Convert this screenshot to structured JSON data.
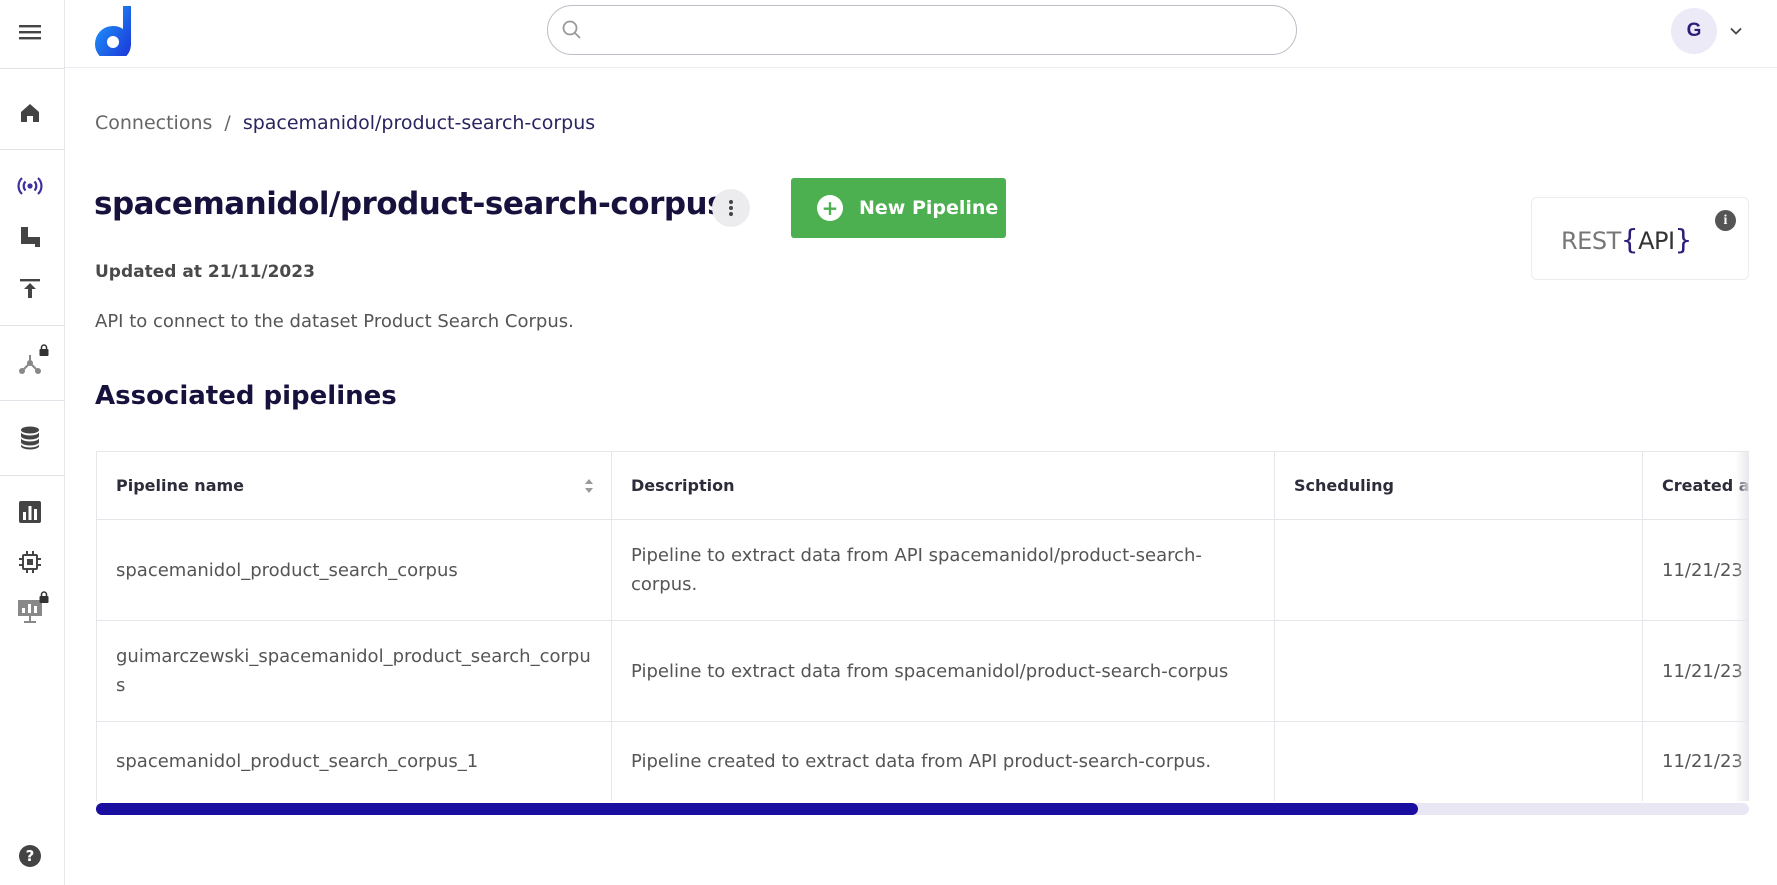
{
  "header": {
    "search": {
      "placeholder": "",
      "value": ""
    },
    "user": {
      "initial": "G"
    }
  },
  "sidebar": {
    "items": [
      {
        "icon": "menu-icon"
      },
      {
        "icon": "home-icon"
      },
      {
        "icon": "broadcast-icon"
      },
      {
        "icon": "pipeline-icon"
      },
      {
        "icon": "upload-icon"
      },
      {
        "icon": "graph-icon",
        "locked": true
      },
      {
        "icon": "database-icon"
      },
      {
        "icon": "bar-chart-icon"
      },
      {
        "icon": "chip-icon"
      },
      {
        "icon": "presentation-icon",
        "locked": true
      },
      {
        "icon": "help-icon"
      }
    ]
  },
  "breadcrumb": {
    "root": "Connections",
    "separator": "/",
    "current": "spacemanidol/product-search-corpus"
  },
  "connection": {
    "title": "spacemanidol/product-search-corpus",
    "updated": "Updated at 21/11/2023",
    "description": "API to connect to the dataset Product Search Corpus."
  },
  "actions": {
    "new_pipeline": "New Pipeline"
  },
  "rest_card": {
    "prefix": "REST",
    "open": "{",
    "api": "API",
    "close": "}"
  },
  "pipelines": {
    "title": "Associated pipelines",
    "columns": [
      "Pipeline name",
      "Description",
      "Scheduling",
      "Created at"
    ],
    "rows": [
      {
        "name": "spacemanidol_product_search_corpus",
        "description": "Pipeline to extract data from API spacemanidol/product-search-corpus.",
        "scheduling": "",
        "created": "11/21/23"
      },
      {
        "name": "guimarczewski_spacemanidol_product_search_corpus",
        "description": "Pipeline to extract data from spacemanidol/product-search-corpus",
        "scheduling": "",
        "created": "11/21/23"
      },
      {
        "name": "spacemanidol_product_search_corpus_1",
        "description": "Pipeline created to extract data from API product-search-corpus.",
        "scheduling": "",
        "created": "11/21/23"
      }
    ],
    "horizontal_scroll_fraction": 0.8
  },
  "colors": {
    "brand": "#2c1f7a",
    "accent_green": "#4caf50",
    "scrollbar": "#1a0ea0"
  }
}
